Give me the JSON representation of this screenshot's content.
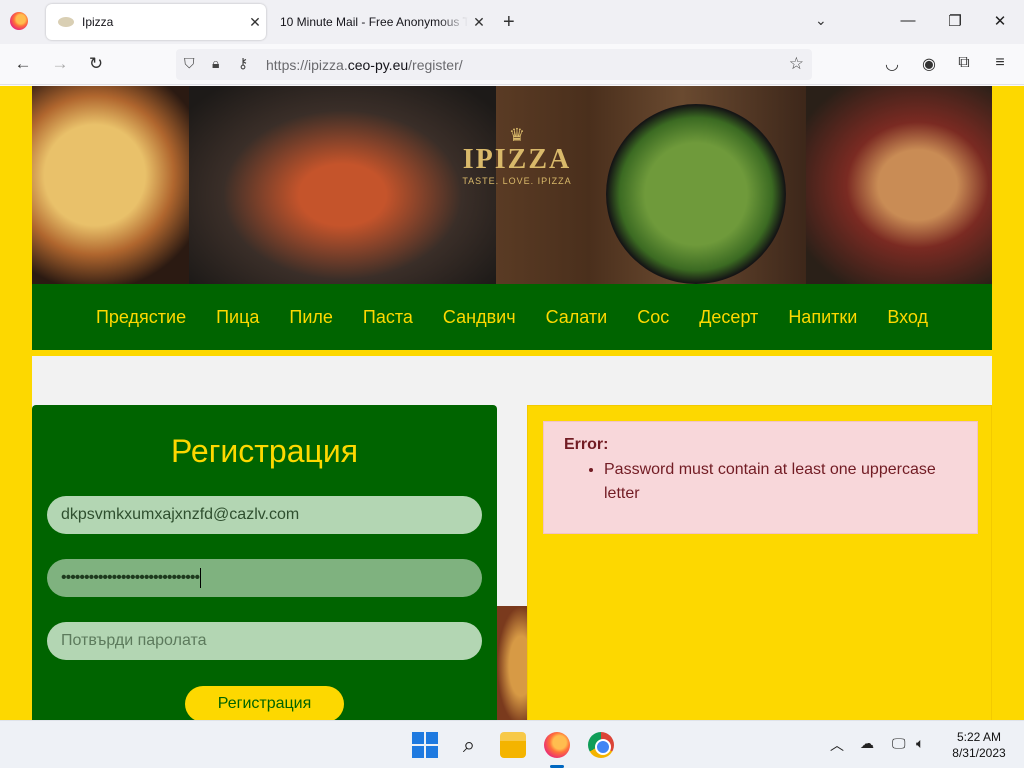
{
  "browser": {
    "tabs": [
      {
        "title": "Ipizza",
        "active": true
      },
      {
        "title": "10 Minute Mail - Free Anonymous T",
        "active": false
      }
    ],
    "url_prefix": "https://ipizza.",
    "url_domain": "ceo-py.eu",
    "url_path": "/register/"
  },
  "site": {
    "logo": {
      "brand": "IPIZZA",
      "tagline": "TASTE. LOVE. IPIZZA"
    },
    "menu": [
      "Предястие",
      "Пица",
      "Пиле",
      "Паста",
      "Сандвич",
      "Салати",
      "Сос",
      "Десерт",
      "Напитки",
      "Вход"
    ],
    "register": {
      "title": "Регистрация",
      "email_value": "dkpsvmkxumxajxnzfd@cazlv.com",
      "password_masked": "••••••••••••••••••••••••••••••",
      "confirm_placeholder": "Потвърди паролата",
      "button": "Регистрация"
    },
    "error": {
      "heading": "Error:",
      "messages": [
        "Password must contain at least one uppercase letter"
      ]
    }
  },
  "taskbar": {
    "time": "5:22 AM",
    "date": "8/31/2023"
  }
}
